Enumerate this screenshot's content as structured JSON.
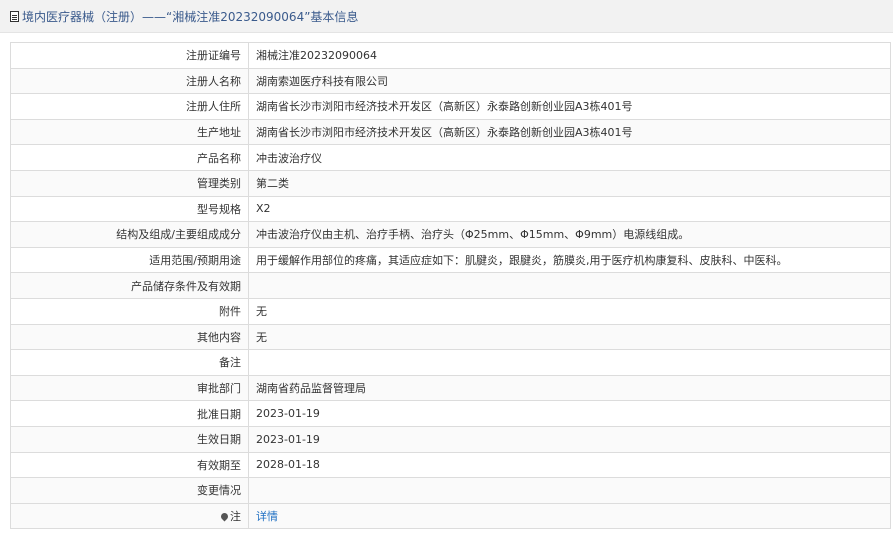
{
  "header": {
    "title": "境内医疗器械（注册）——“湘械注准20232090064”基本信息"
  },
  "rows": [
    {
      "label": "注册证编号",
      "value": "湘械注准20232090064"
    },
    {
      "label": "注册人名称",
      "value": "湖南索迦医疗科技有限公司"
    },
    {
      "label": "注册人住所",
      "value": "湖南省长沙市浏阳市经济技术开发区（高新区）永泰路创新创业园A3栋401号"
    },
    {
      "label": "生产地址",
      "value": "湖南省长沙市浏阳市经济技术开发区（高新区）永泰路创新创业园A3栋401号"
    },
    {
      "label": "产品名称",
      "value": "冲击波治疗仪"
    },
    {
      "label": "管理类别",
      "value": "第二类"
    },
    {
      "label": "型号规格",
      "value": "X2"
    },
    {
      "label": "结构及组成/主要组成成分",
      "value": "冲击波治疗仪由主机、治疗手柄、治疗头（Φ25mm、Φ15mm、Φ9mm）电源线组成。"
    },
    {
      "label": "适用范围/预期用途",
      "value": "用于缓解作用部位的疼痛，其适应症如下：肌腱炎，跟腱炎，筋膜炎,用于医疗机构康复科、皮肤科、中医科。"
    },
    {
      "label": "产品储存条件及有效期",
      "value": ""
    },
    {
      "label": "附件",
      "value": "无"
    },
    {
      "label": "其他内容",
      "value": "无"
    },
    {
      "label": "备注",
      "value": ""
    },
    {
      "label": "审批部门",
      "value": "湖南省药品监督管理局"
    },
    {
      "label": "批准日期",
      "value": "2023-01-19"
    },
    {
      "label": "生效日期",
      "value": "2023-01-19"
    },
    {
      "label": "有效期至",
      "value": "2028-01-18"
    },
    {
      "label": "变更情况",
      "value": ""
    }
  ],
  "note_row": {
    "label": "注",
    "link_text": "详情"
  }
}
